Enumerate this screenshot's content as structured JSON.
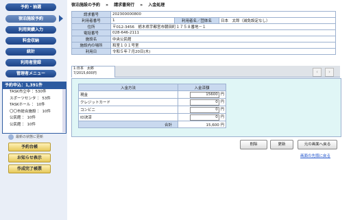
{
  "sidebar": {
    "nav": [
      "予約・抽選",
      "宿泊施設予約",
      "利用実績入力",
      "料金収納",
      "統計",
      "利用者登録",
      "管理者メニュー"
    ],
    "panel_title": "予約申込：1,391件",
    "panel_rows": [
      "TASK市立中 ：530件",
      "スポーツセンタ ： 53件",
      "TASKホール ： 10件",
      "〇〇市総合施設 ： 10件",
      "公民館 ： 10件",
      "公民館 ： 10件"
    ],
    "refresh_label": "最新の状態に更新",
    "yellow_buttons": [
      "予約台帳",
      "お知らせ表示",
      "作成完了帳票"
    ]
  },
  "breadcrumb": [
    "宿泊施設の予約",
    "»",
    "請求書発行",
    "»",
    "入金処理"
  ],
  "info": {
    "invoice_no_label": "請求番号",
    "invoice_no": "202300000800",
    "user_no_label": "利用者番号",
    "user_no": "1",
    "user_name_label": "利用者名／団体名",
    "user_name": "日本　太郎（減免設定なし）",
    "address_label": "住所",
    "address": "〒012-3456　栃木県宇都宮市朝田町１７５８番地－１",
    "phone_label": "電話番号",
    "phone": "028-646-2111",
    "facility_label": "施設名",
    "facility": "中央公民館",
    "room_label": "施設内の場所",
    "room": "和室１０１号室",
    "date_label": "利用日",
    "date": "令和５年７月20日(木)"
  },
  "tab": {
    "line1": "1:日本　太郎",
    "line2": "7/2015,600円"
  },
  "payment": {
    "method_header": "入金方法",
    "amount_header": "入金済額",
    "yen": "円",
    "rows": [
      {
        "method": "現金",
        "amount": "15600"
      },
      {
        "method": "クレジットカード",
        "amount": "0"
      },
      {
        "method": "コンビニ",
        "amount": "0"
      },
      {
        "method": "ID決済",
        "amount": "0"
      }
    ],
    "total_label": "合計",
    "total": "15,600 円"
  },
  "actions": {
    "delete": "削除",
    "update": "更新",
    "back": "元の画面へ戻る",
    "top_link": "画面の先頭に戻る"
  },
  "nav_arrows": {
    "prev": "‹",
    "next": "›"
  }
}
